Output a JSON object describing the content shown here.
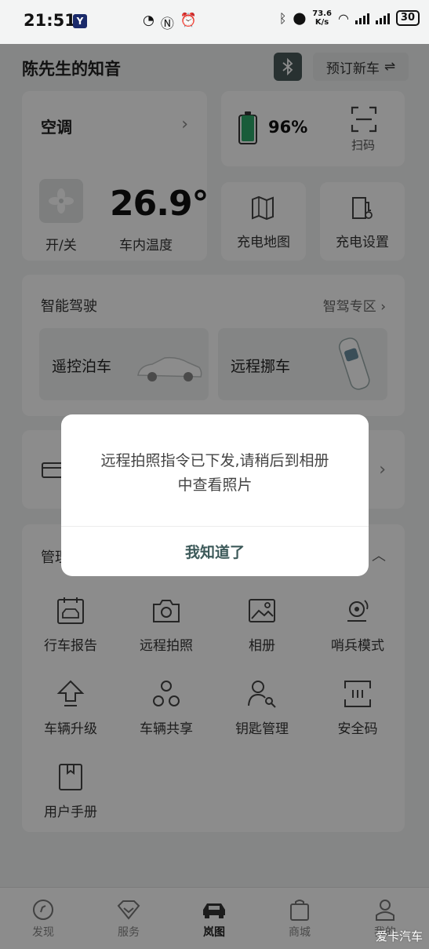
{
  "status_bar": {
    "time": "21:51",
    "app_badge": "Y",
    "net_speed_value": "73.6",
    "net_speed_unit": "K/s",
    "battery": "30"
  },
  "header": {
    "title": "陈先生的知音",
    "order_label": "预订新车",
    "order_icon": "swap-arrows-icon",
    "bluetooth_icon": "bluetooth-icon"
  },
  "ac": {
    "title": "空调",
    "temperature": "26.9°",
    "power_label": "开/关",
    "temp_label": "车内温度"
  },
  "battery_card": {
    "percent": "96%",
    "scan_label": "扫码",
    "level": 0.96,
    "fill_color": "#2ea86a"
  },
  "quick": {
    "map_label": "充电地图",
    "settings_label": "充电设置"
  },
  "driving": {
    "title": "智能驾驶",
    "link_label": "智驾专区",
    "remote_park_label": "遥控泊车",
    "remote_move_label": "远程挪车"
  },
  "manage": {
    "title": "管理",
    "items": [
      {
        "label": "行车报告",
        "icon": "calendar-car-icon"
      },
      {
        "label": "远程拍照",
        "icon": "camera-icon"
      },
      {
        "label": "相册",
        "icon": "gallery-icon"
      },
      {
        "label": "哨兵模式",
        "icon": "sentry-icon"
      },
      {
        "label": "车辆升级",
        "icon": "upgrade-icon"
      },
      {
        "label": "车辆共享",
        "icon": "share-icon"
      },
      {
        "label": "钥匙管理",
        "icon": "key-icon"
      },
      {
        "label": "安全码",
        "icon": "security-code-icon"
      },
      {
        "label": "用户手册",
        "icon": "manual-icon"
      }
    ]
  },
  "bottom_nav": {
    "items": [
      {
        "label": "发现"
      },
      {
        "label": "服务"
      },
      {
        "label": "岚图"
      },
      {
        "label": "商城"
      },
      {
        "label": "我的"
      }
    ],
    "active_index": 2
  },
  "dialog": {
    "message_line1": "远程拍照指令已下发,请稍后到相册",
    "message_line2": "中查看照片",
    "confirm_label": "我知道了"
  },
  "watermark": "爱卡汽车",
  "colors": {
    "accent": "#3d5a5a",
    "battery_green": "#2ea86a",
    "overlay": "rgba(0,0,0,0.45)"
  }
}
